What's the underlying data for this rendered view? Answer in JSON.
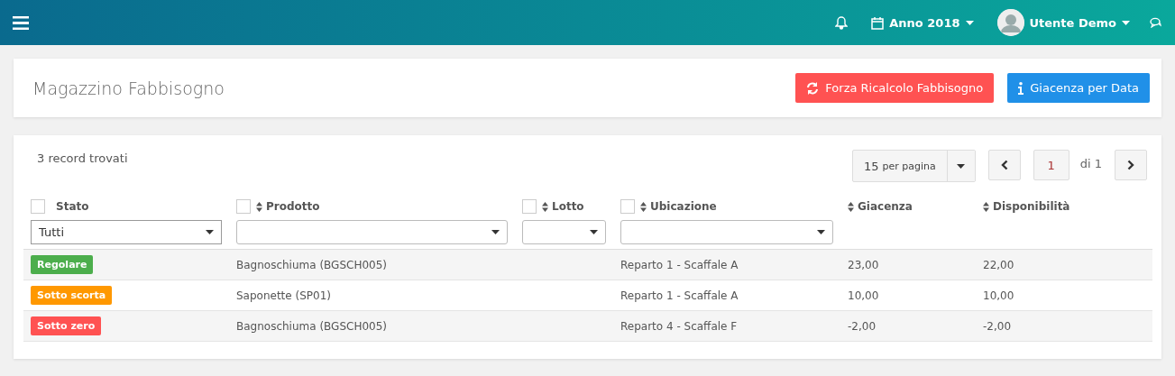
{
  "topbar": {
    "year": "Anno 2018",
    "user": "Utente Demo"
  },
  "page": {
    "title": "Magazzino Fabbisogno",
    "buttons": [
      {
        "label": "Forza Ricalcolo Fabbisogno",
        "kind": "danger"
      },
      {
        "label": "Giacenza per Data",
        "kind": "info"
      }
    ]
  },
  "list": {
    "count": "3 record trovati",
    "page_size": "15",
    "page_size_unit": "per pagina",
    "current_page": "1",
    "total_pages": "di 1",
    "columns": [
      {
        "label": "Stato",
        "checkbox": true,
        "sortable": false,
        "kind": "select",
        "filter_value": "Tutti",
        "checked": false
      },
      {
        "label": "Prodotto",
        "checkbox": true,
        "sortable": true,
        "kind": "combo",
        "checked": false
      },
      {
        "label": "Lotto",
        "checkbox": true,
        "sortable": true,
        "kind": "combo",
        "checked": false
      },
      {
        "label": "Ubicazione",
        "checkbox": true,
        "sortable": true,
        "kind": "combo",
        "checked": false
      },
      {
        "label": "Giacenza",
        "checkbox": false,
        "sortable": true,
        "kind": "plain"
      },
      {
        "label": "Disponibilità",
        "checkbox": false,
        "sortable": true,
        "kind": "plain"
      }
    ],
    "rows": [
      {
        "status": "Regolare",
        "color": "#4cae4c",
        "product": "Bagnoschiuma (BGSCH005)",
        "location": "Reparto 1 - Scaffale A",
        "stock": "23,00",
        "available": "22,00"
      },
      {
        "status": "Sotto scorta",
        "color": "#ff9800",
        "product": "Saponette (SP01)",
        "location": "Reparto 1 - Scaffale A",
        "stock": "10,00",
        "available": "10,00"
      },
      {
        "status": "Sotto zero",
        "color": "#ff5252",
        "product": "Bagnoschiuma (BGSCH005)",
        "location": "Reparto 4 - Scaffale F",
        "stock": "-2,00",
        "available": "-2,00"
      }
    ]
  }
}
